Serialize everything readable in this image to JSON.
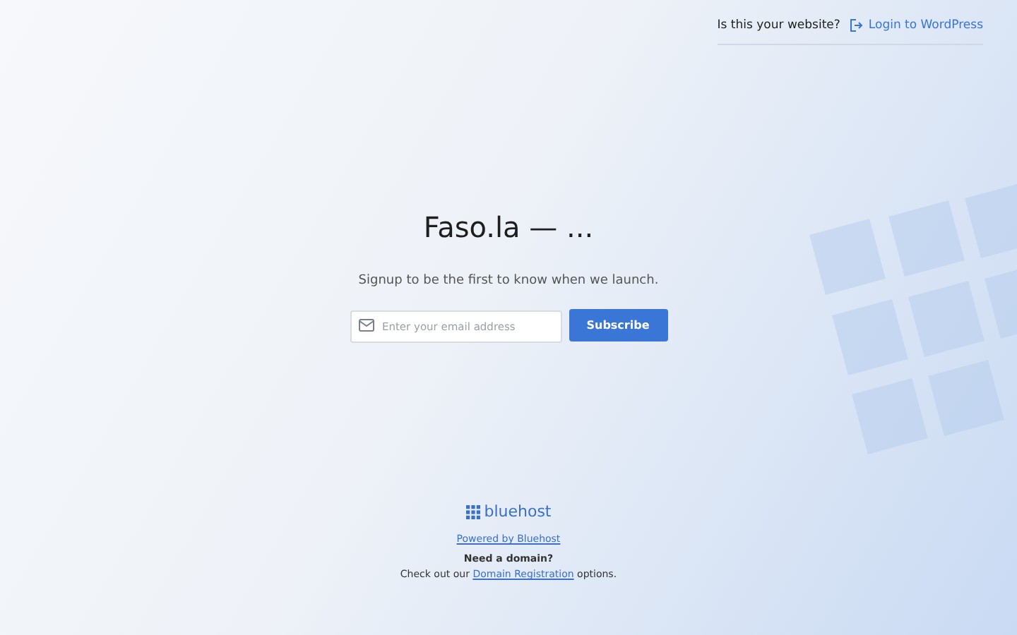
{
  "header": {
    "question": "Is this your website?",
    "login_link": "Login to WordPress"
  },
  "title": "Faso.la — ...",
  "tagline": "Signup to be the first to know when we launch.",
  "signup_form": {
    "email_placeholder": "Enter your email address",
    "button": "Subscribe"
  },
  "footer": {
    "logo": "bluehost",
    "powered_by": "Powered by Bluehost",
    "domain_heading": "Need a domain?",
    "domain_text_before": "Check out our",
    "domain_link": "Domain Registration",
    "domain_text_after": "options."
  }
}
